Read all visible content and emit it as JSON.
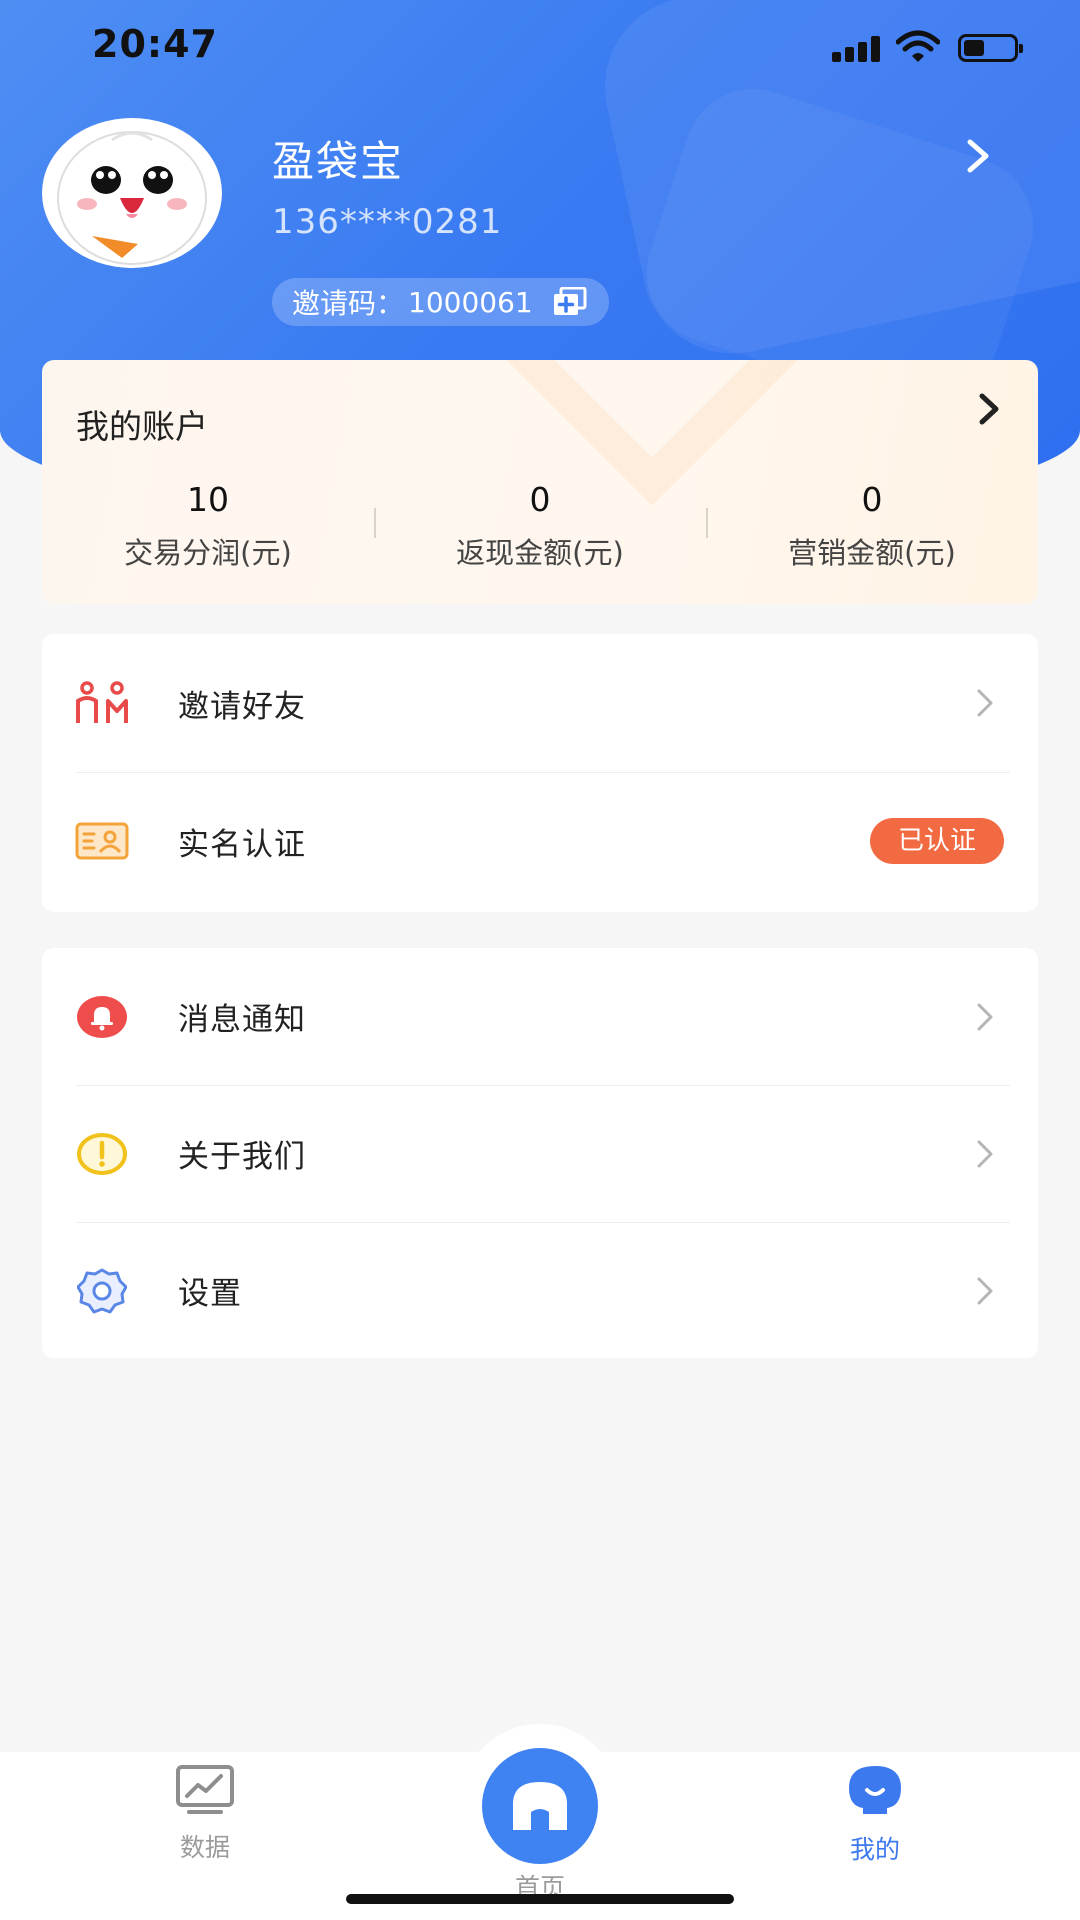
{
  "status_bar": {
    "time": "20:47"
  },
  "profile": {
    "name": "盈袋宝",
    "phone": "136****0281",
    "invite_label": "邀请码：",
    "invite_code": "1000061"
  },
  "account": {
    "title": "我的账户",
    "stats": [
      {
        "value": "10",
        "label": "交易分润(元)"
      },
      {
        "value": "0",
        "label": "返现金额(元)"
      },
      {
        "value": "0",
        "label": "营销金额(元)"
      }
    ]
  },
  "menu_group_1": [
    {
      "label": "邀请好友",
      "icon": "invite-friends-icon"
    },
    {
      "label": "实名认证",
      "icon": "id-card-icon",
      "badge": "已认证"
    }
  ],
  "menu_group_2": [
    {
      "label": "消息通知",
      "icon": "bell-icon"
    },
    {
      "label": "关于我们",
      "icon": "info-icon"
    },
    {
      "label": "设置",
      "icon": "gear-icon"
    }
  ],
  "tabbar": {
    "data": "数据",
    "home": "首页",
    "mine": "我的",
    "active": "mine"
  },
  "colors": {
    "header_blue": "#3a7bf2",
    "badge_orange": "#f26a42",
    "active_tab": "#3d79ee"
  }
}
